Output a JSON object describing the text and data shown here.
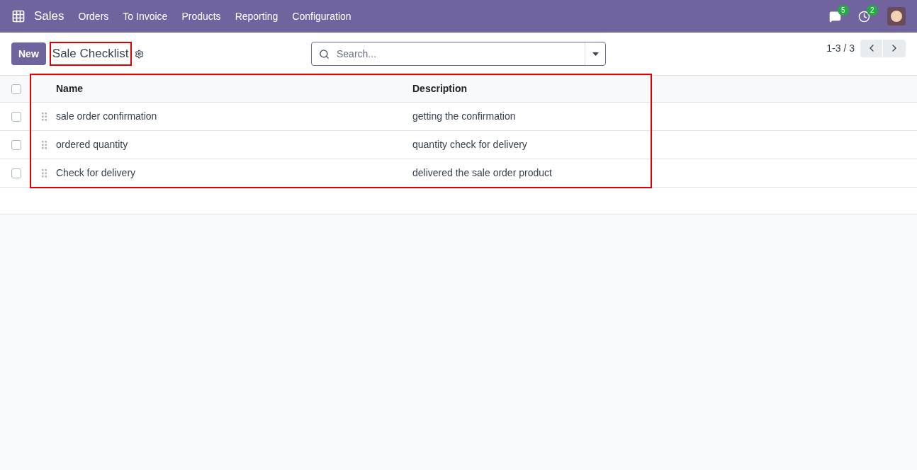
{
  "navbar": {
    "app": "Sales",
    "menu": [
      "Orders",
      "To Invoice",
      "Products",
      "Reporting",
      "Configuration"
    ],
    "messages_count": "5",
    "activities_count": "2"
  },
  "control_panel": {
    "new_button": "New",
    "title": "Sale Checklist",
    "search": {
      "placeholder": "Search..."
    },
    "pager": "1-3 / 3"
  },
  "table": {
    "select_all": {
      "checked": false
    },
    "columns": [
      "Name",
      "Description"
    ],
    "rows": [
      {
        "checked": false,
        "name": "sale order confirmation",
        "description": "getting the confirmation"
      },
      {
        "checked": false,
        "name": "ordered quantity",
        "description": "quantity check for delivery"
      },
      {
        "checked": false,
        "name": "Check for delivery",
        "description": "delivered the sale order product"
      }
    ]
  }
}
